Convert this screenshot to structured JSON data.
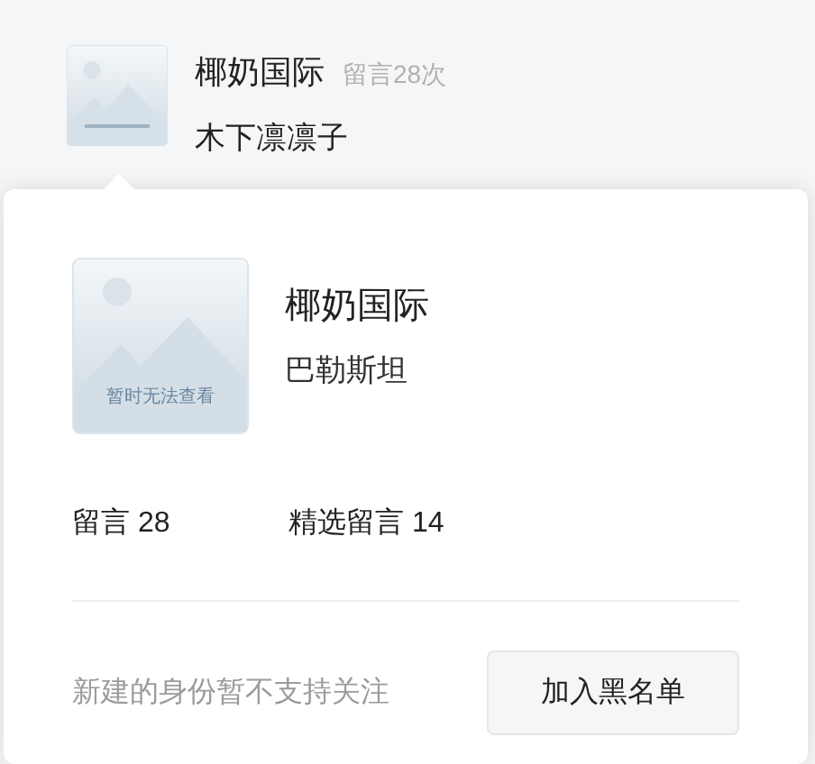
{
  "comment": {
    "author": "椰奶国际",
    "count": "留言28次",
    "text": "木下凛凛子"
  },
  "profile_card": {
    "placeholder_text": "暂时无法查看",
    "name": "椰奶国际",
    "region": "巴勒斯坦",
    "stats": [
      {
        "label": "留言",
        "value": "28"
      },
      {
        "label": "精选留言",
        "value": "14"
      }
    ],
    "note": "新建的身份暂不支持关注",
    "button": "加入黑名单"
  }
}
